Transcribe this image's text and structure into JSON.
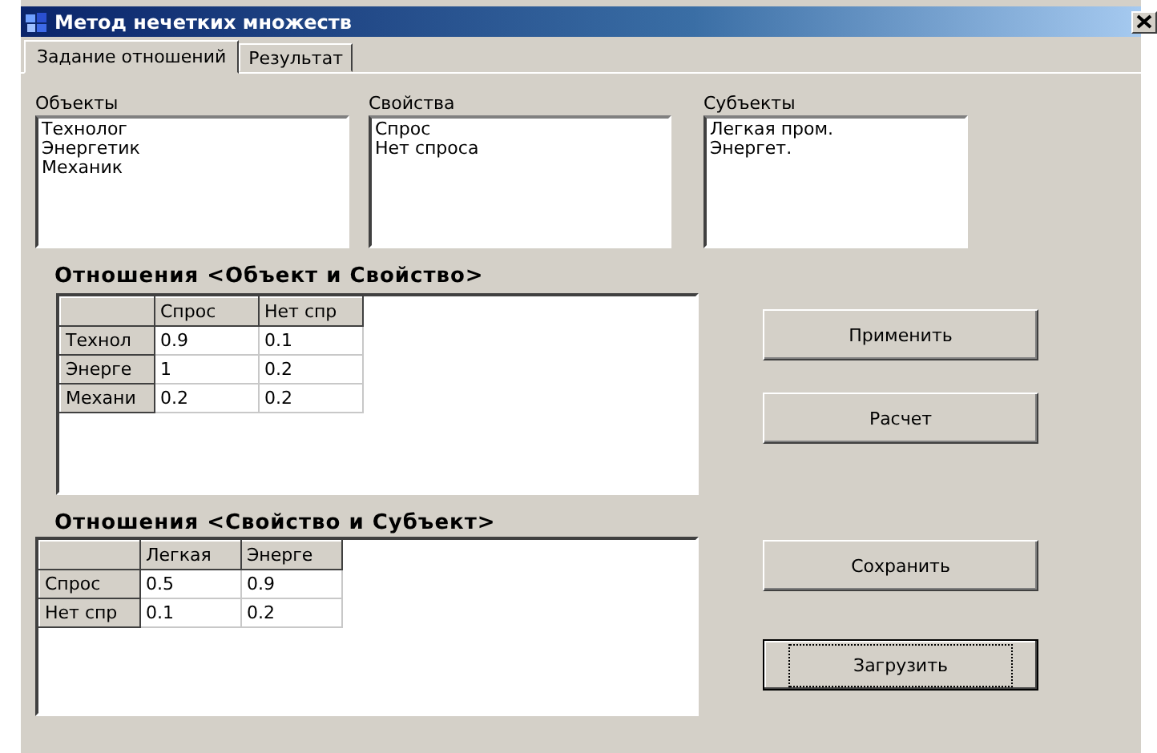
{
  "window": {
    "title": "Метод нечетких множеств"
  },
  "tabs": [
    {
      "label": "Задание отношений",
      "selected": true
    },
    {
      "label": "Результат",
      "selected": false
    }
  ],
  "lists": [
    {
      "label": "Объекты",
      "items": [
        "Технолог",
        "Энергетик",
        "Механик"
      ]
    },
    {
      "label": "Свойства",
      "items": [
        "Спрос",
        "Нет спроса"
      ]
    },
    {
      "label": "Субъекты",
      "items": [
        "Легкая пром.",
        "Энергет."
      ]
    }
  ],
  "grids": [
    {
      "title": "Отношения <Объект и Свойство>",
      "columns": [
        "Спрос",
        "Нет спр"
      ],
      "rows": [
        {
          "header": "Технол",
          "cells": [
            "0.9",
            "0.1"
          ]
        },
        {
          "header": "Энерге",
          "cells": [
            "1",
            "0.2"
          ]
        },
        {
          "header": "Механи",
          "cells": [
            "0.2",
            "0.2"
          ]
        }
      ]
    },
    {
      "title": "Отношения <Свойство и Субъект>",
      "columns": [
        "Легкая",
        "Энерге"
      ],
      "rows": [
        {
          "header": "Спрос",
          "cells": [
            "0.5",
            "0.9"
          ]
        },
        {
          "header": "Нет спр",
          "cells": [
            "0.1",
            "0.2"
          ]
        }
      ]
    }
  ],
  "buttons": [
    {
      "label": "Применить",
      "focused": false
    },
    {
      "label": "Расчет",
      "focused": false
    },
    {
      "label": "Сохранить",
      "focused": false
    },
    {
      "label": "Загрузить",
      "focused": true
    }
  ]
}
